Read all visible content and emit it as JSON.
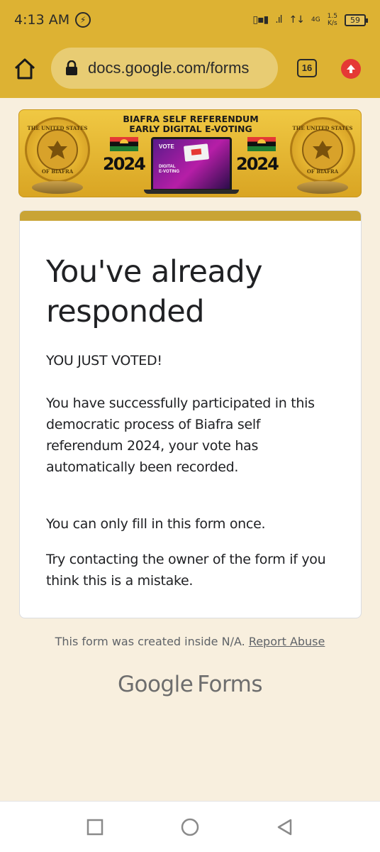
{
  "status_bar": {
    "time": "4:13 AM",
    "alarm_icon": "alarm-icon",
    "network_type": "4G",
    "net_speed_value": "1.5",
    "net_speed_unit": "K/s",
    "battery_level": "59"
  },
  "browser": {
    "url": "docs.google.com/forms",
    "tab_count": "16",
    "home_icon": "home-icon",
    "lock_icon": "lock-icon",
    "update_icon": "update-arrow-icon"
  },
  "banner": {
    "title_line1": "BIAFRA SELF REFERENDUM",
    "title_line2": "EARLY DIGITAL E-VOTING",
    "year_left": "2024",
    "year_right": "2024",
    "seal_top_text": "THE UNITED STATES",
    "seal_bottom_text": "OF BIAFRA",
    "screen_vote_label": "VOTE",
    "screen_caption_line1": "DIGITAL",
    "screen_caption_line2": "E-VOTING"
  },
  "card": {
    "title_line1": "You've already",
    "title_line2": "responded",
    "voted_text": "YOU JUST VOTED!",
    "para1_line1": "You have successfully participated in this",
    "para1_line2": "democratic process of Biafra self",
    "para1_line3": "referendum 2024, your vote has",
    "para1_line4": "automatically been recorded.",
    "once_text": "You can only fill in this form once.",
    "contact_line1": "Try contacting the owner of the form if you",
    "contact_line2": "think this is a mistake."
  },
  "footer": {
    "created_text": "This form was created inside N/A.",
    "report_link": "Report Abuse",
    "brand_google": "Google",
    "brand_forms": "Forms"
  },
  "nav": {
    "recents_icon": "square-recents-icon",
    "home_icon": "circle-home-icon",
    "back_icon": "triangle-back-icon"
  },
  "colors": {
    "toolbar": "#ddb233",
    "page_bg": "#f8efde",
    "card_accent": "#c9a435"
  }
}
